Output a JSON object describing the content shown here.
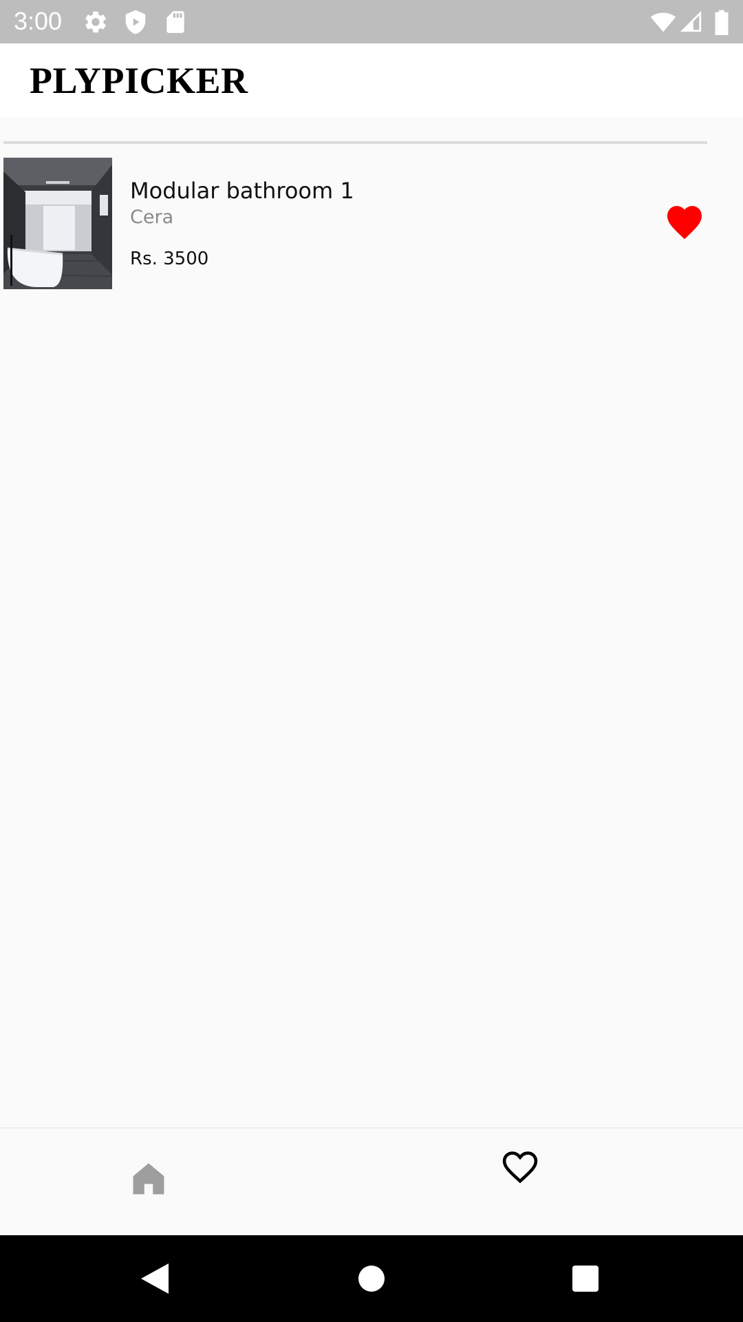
{
  "status_bar": {
    "time": "3:00",
    "icons": [
      "settings-icon",
      "shield-icon",
      "sd-card-icon",
      "wifi-icon",
      "cell-signal-icon",
      "battery-icon"
    ]
  },
  "app_bar": {
    "title": "PLYPICKER"
  },
  "favorites": {
    "items": [
      {
        "name": "Modular bathroom 1",
        "brand": "Cera",
        "price": "Rs. 3500",
        "favorited": true,
        "image": "bathroom-photo"
      }
    ]
  },
  "bottom_nav": {
    "items": [
      {
        "icon": "home-icon",
        "active": false
      },
      {
        "icon": "heart-outline-icon",
        "active": true
      }
    ]
  },
  "colors": {
    "status_bar": "#bdbdbd",
    "app_bar": "#ffffff",
    "background": "#fafafa",
    "heart": "#ff0000",
    "nav_inactive": "#9e9e9e",
    "nav_active": "#000000",
    "brand_text": "#8a8a8a"
  }
}
